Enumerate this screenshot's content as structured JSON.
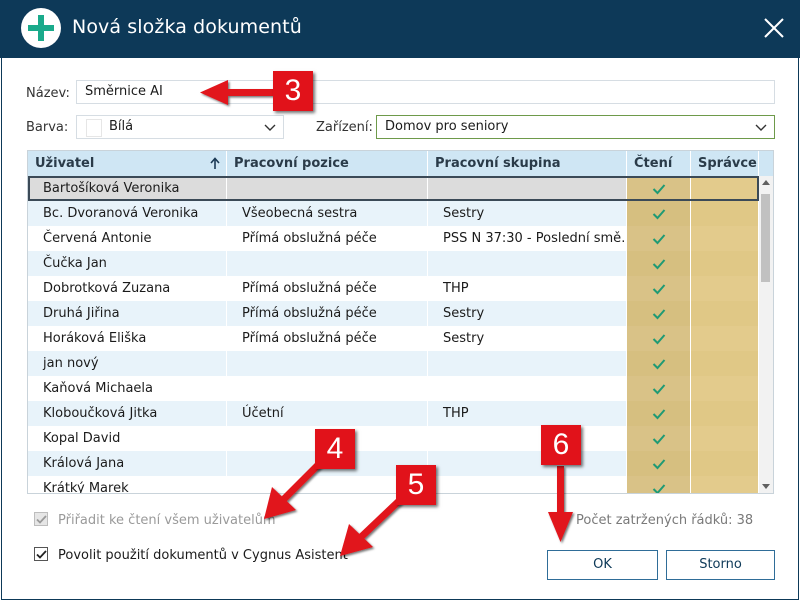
{
  "window": {
    "title": "Nová složka dokumentů",
    "title_icon": "plus-circle-icon",
    "close_icon": "close-icon",
    "titlebar_color": "#0d3958",
    "accent_color": "#1aaa8b"
  },
  "form": {
    "name_label": "Název:",
    "name_value": "Směrnice AI",
    "color_label": "Barva:",
    "color_value": "Bílá",
    "facility_label": "Zařízení:",
    "facility_value": "Domov pro seniory"
  },
  "grid": {
    "columns": [
      "Uživatel",
      "Pracovní pozice",
      "Pracovní skupina",
      "Čtení",
      "Správce"
    ],
    "rows": [
      {
        "user": "Bartošíková Veronika",
        "position": "",
        "group": "",
        "read": true,
        "admin": false
      },
      {
        "user": "Bc. Dvoranová Veronika",
        "position": "Všeobecná sestra",
        "group": "Sestry",
        "read": true,
        "admin": false
      },
      {
        "user": "Červená Antonie",
        "position": "Přímá obslužná péče",
        "group": "PSS N 37:30 - Poslední smě…",
        "read": true,
        "admin": false
      },
      {
        "user": "Čučka Jan",
        "position": "",
        "group": "",
        "read": true,
        "admin": false
      },
      {
        "user": "Dobrotková Zuzana",
        "position": "Přímá obslužná péče",
        "group": "THP",
        "read": true,
        "admin": false
      },
      {
        "user": "Druhá Jiřina",
        "position": "Přímá obslužná péče",
        "group": "Sestry",
        "read": true,
        "admin": false
      },
      {
        "user": "Horáková Eliška",
        "position": "Přímá obslužná péče",
        "group": "Sestry",
        "read": true,
        "admin": false
      },
      {
        "user": "jan nový",
        "position": "",
        "group": "",
        "read": true,
        "admin": false
      },
      {
        "user": "Kaňová Michaela",
        "position": "",
        "group": "",
        "read": true,
        "admin": false
      },
      {
        "user": "Kloboučková Jitka",
        "position": "Účetní",
        "group": "THP",
        "read": true,
        "admin": false
      },
      {
        "user": "Kopal David",
        "position": "",
        "group": "",
        "read": true,
        "admin": false
      },
      {
        "user": "Králová Jana",
        "position": "",
        "group": "",
        "read": true,
        "admin": false
      },
      {
        "user": "Krátký Marek",
        "position": "",
        "group": "",
        "read": true,
        "admin": false
      }
    ],
    "selected_row": 0,
    "sort_column": "Uživatel",
    "sort_direction": "ascending"
  },
  "options": {
    "assign_read_label": "Přiřadit ke čtení všem uživatelům",
    "assign_read_checked": true,
    "assign_read_enabled": false,
    "allow_assistant_label": "Povolit použití dokumentů v Cygnus Asistent",
    "allow_assistant_checked": true,
    "row_count_label": "Počet zatržených řádků: 38"
  },
  "buttons": {
    "ok_label": "OK",
    "cancel_label": "Storno"
  },
  "annotations": {
    "callouts": [
      "3",
      "4",
      "5",
      "6"
    ],
    "color": "#e1121a"
  }
}
